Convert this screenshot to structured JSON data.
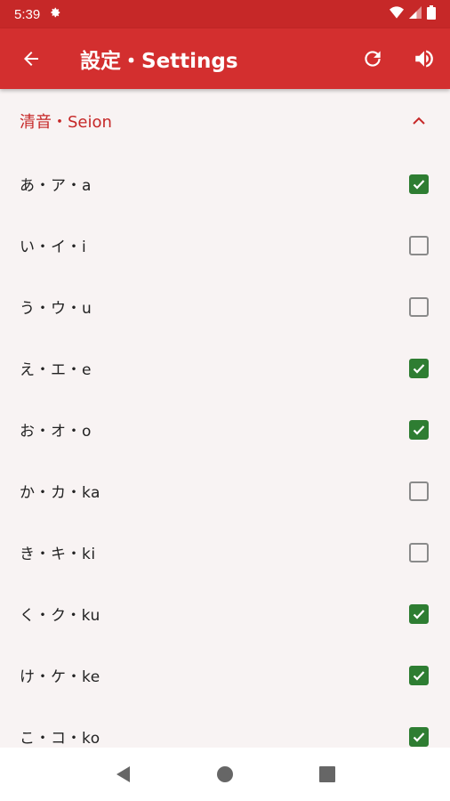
{
  "status_bar": {
    "time": "5:39",
    "icons": [
      "gear-icon",
      "wifi-icon",
      "signal-icon",
      "battery-icon"
    ]
  },
  "app_bar": {
    "title": "設定・Settings",
    "back_icon": "arrow-back-icon",
    "actions": [
      "refresh-icon",
      "volume-icon"
    ]
  },
  "section": {
    "title": "清音・Seion",
    "expanded": true
  },
  "rows": [
    {
      "label": "あ・ア・a",
      "checked": true
    },
    {
      "label": "い・イ・i",
      "checked": false
    },
    {
      "label": "う・ウ・u",
      "checked": false
    },
    {
      "label": "え・エ・e",
      "checked": true
    },
    {
      "label": "お・オ・o",
      "checked": true
    },
    {
      "label": "か・カ・ka",
      "checked": false
    },
    {
      "label": "き・キ・ki",
      "checked": false
    },
    {
      "label": "く・ク・ku",
      "checked": true
    },
    {
      "label": "け・ケ・ke",
      "checked": true
    },
    {
      "label": "こ・コ・ko",
      "checked": true
    }
  ],
  "colors": {
    "app_bar": "#d32f2f",
    "status_bar": "#c62828",
    "accent": "#c62828",
    "checkbox_on": "#2e7d32",
    "background": "#f8f3f3"
  }
}
